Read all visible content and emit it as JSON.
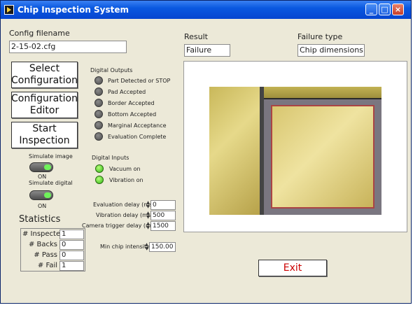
{
  "window": {
    "title": "Chip Inspection System",
    "minimize": "_",
    "maximize": "□",
    "close": "×"
  },
  "config": {
    "label": "Config filename",
    "value": "2-15-02.cfg"
  },
  "buttons": {
    "select_config": "Select Configuration",
    "config_editor": "Configuration Editor",
    "start_inspection": "Start Inspection",
    "exit": "Exit"
  },
  "simulate": {
    "image_label": "Simulate image",
    "image_state": "ON",
    "digital_label": "Simulate digital",
    "digital_state": "ON"
  },
  "digital_outputs": {
    "title": "Digital Outputs",
    "items": [
      {
        "label": "Part Detected or STOP",
        "on": false
      },
      {
        "label": "Pad Accepted",
        "on": false
      },
      {
        "label": "Border Accepted",
        "on": false
      },
      {
        "label": "Bottom Accepted",
        "on": false
      },
      {
        "label": "Marginal Acceptance",
        "on": false
      },
      {
        "label": "Evaluation Complete",
        "on": false
      }
    ]
  },
  "digital_inputs": {
    "title": "Digital Inputs",
    "items": [
      {
        "label": "Vacuum on",
        "on": true
      },
      {
        "label": "Vibration on",
        "on": true
      }
    ]
  },
  "delays": {
    "evaluation_label": "Evaluation delay (ms)",
    "evaluation_value": "0",
    "vibration_label": "Vibration delay (ms)",
    "vibration_value": "500",
    "camera_label": "Camera trigger delay (ms)",
    "camera_value": "1500",
    "min_intensity_label": "Min chip intensity",
    "min_intensity_value": "150.00"
  },
  "statistics": {
    "title": "Statistics",
    "inspected_label": "# Inspected",
    "inspected_value": "1",
    "backs_label": "# Backs",
    "backs_value": "0",
    "pass_label": "# Pass",
    "pass_value": "0",
    "fail_label": "# Fail",
    "fail_value": "1"
  },
  "result": {
    "label": "Result",
    "value": "Failure",
    "failure_type_label": "Failure type",
    "failure_type_value": "Chip dimensions"
  },
  "colors": {
    "title_bar": "#0a58e0",
    "led_on": "#2fb814",
    "led_off": "#5a5a5a",
    "exit_text": "#cc0000"
  }
}
